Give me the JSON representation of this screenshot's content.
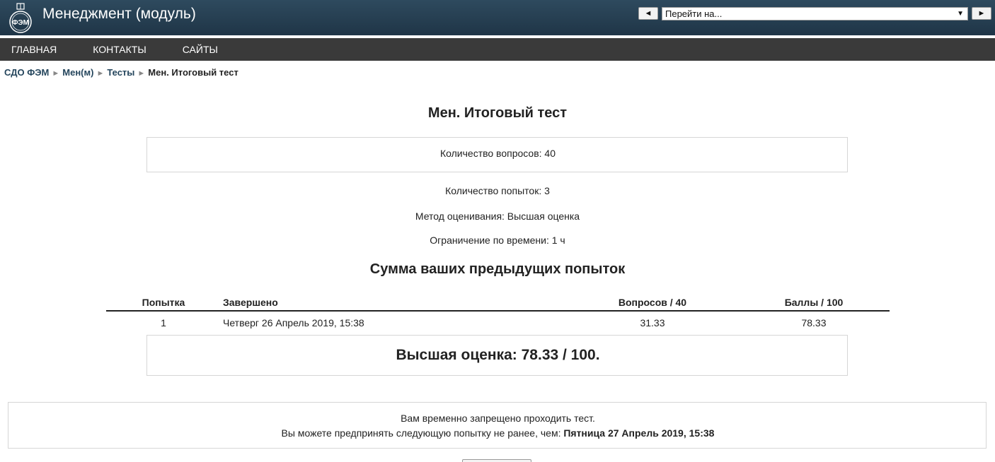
{
  "header": {
    "logo_text": "ФЭМ",
    "title": "Менеджмент (модуль)",
    "jump": {
      "prev_label": "◄",
      "select_value": "Перейти на...",
      "caret": "▼",
      "next_label": "►"
    }
  },
  "nav": {
    "items": [
      {
        "label": "ГЛАВНАЯ"
      },
      {
        "label": "КОНТАКТЫ"
      },
      {
        "label": "САЙТЫ"
      }
    ]
  },
  "breadcrumb": {
    "separator": "►",
    "items": [
      {
        "label": "СДО ФЭМ"
      },
      {
        "label": "Мен(м)"
      },
      {
        "label": "Тесты"
      }
    ],
    "current": "Мен. Итоговый тест"
  },
  "quiz": {
    "title": "Мен. Итоговый тест",
    "questions_count": "Количество вопросов: 40",
    "attempts_allowed": "Количество попыток: 3",
    "grading_method": "Метод оценивания: Высшая оценка",
    "time_limit": "Ограничение по времени: 1 ч"
  },
  "summary": {
    "title": "Сумма ваших предыдущих попыток",
    "columns": [
      "Попытка",
      "Завершено",
      "Вопросов / 40",
      "Баллы / 100"
    ],
    "rows": [
      {
        "attempt": "1",
        "completed": "Четверг 26 Апрель 2019, 15:38",
        "questions": "31.33",
        "score": "78.33"
      }
    ],
    "best_grade": "Высшая оценка: 78.33 / 100."
  },
  "notice": {
    "line1": "Вам временно запрещено проходить тест.",
    "line2_prefix": "Вы можете предпринять следующую попытку не ранее, чем: ",
    "line2_date": "Пятница 27 Апрель 2019, 15:38"
  }
}
